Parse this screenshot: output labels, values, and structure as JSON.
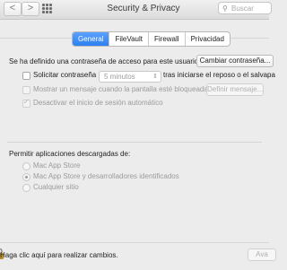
{
  "window": {
    "title": "Security & Privacy",
    "search_placeholder": "Buscar",
    "back_symbol": "<",
    "forward_symbol": ">"
  },
  "tabs": [
    {
      "label": "General",
      "active": true
    },
    {
      "label": "FileVault",
      "active": false
    },
    {
      "label": "Firewall",
      "active": false
    },
    {
      "label": "Privacidad",
      "active": false
    }
  ],
  "general": {
    "password_set_label": "Se ha definido una contraseña de acceso para este usuario",
    "change_password_button": "Cambiar contraseña...",
    "require_password": {
      "label": "Solicitar contraseña",
      "select_value": "5 minutos",
      "after_label": "tras iniciarse el reposo o el salvapa",
      "checked": false
    },
    "show_message": {
      "label": "Mostrar un mensaje cuando la pantalla esté bloqueada",
      "button": "Definir mensaje...",
      "checked": false
    },
    "disable_autologin": {
      "label": "Desactivar el inicio de sesión automático",
      "checked": true
    }
  },
  "downloads": {
    "heading": "Permitir aplicaciones descargadas de:",
    "options": [
      {
        "label": "Mac App Store",
        "selected": false
      },
      {
        "label": "Mac App Store y desarrolladores identificados",
        "selected": true
      },
      {
        "label": "Cualquier sitio",
        "selected": false
      }
    ]
  },
  "footer": {
    "lock_text": "Haga clic aquí para realizar cambios.",
    "advanced_button": "Ava"
  }
}
